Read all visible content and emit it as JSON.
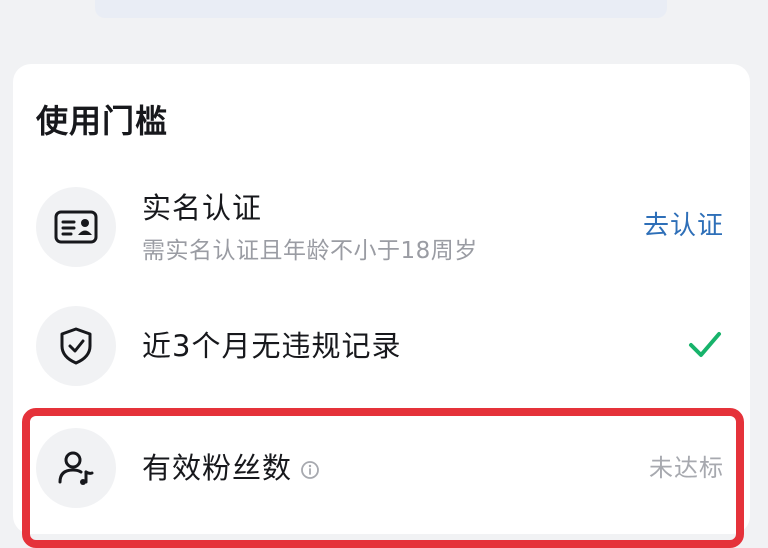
{
  "section": {
    "title": "使用门槛"
  },
  "requirements": [
    {
      "icon": "id-card-icon",
      "title": "实名认证",
      "subtitle": "需实名认证且年龄不小于18周岁",
      "action_label": "去认证"
    },
    {
      "icon": "shield-check-icon",
      "title": "近3个月无违规记录",
      "status": "checkmark"
    },
    {
      "icon": "user-music-icon",
      "title": "有效粉丝数",
      "info_icon": "info-icon",
      "status_label": "未达标"
    }
  ],
  "colors": {
    "background": "#f1f2f4",
    "card": "#ffffff",
    "link": "#2e6fb8",
    "success": "#17b36b",
    "highlight": "#e5323a",
    "muted": "#a7a9af"
  }
}
